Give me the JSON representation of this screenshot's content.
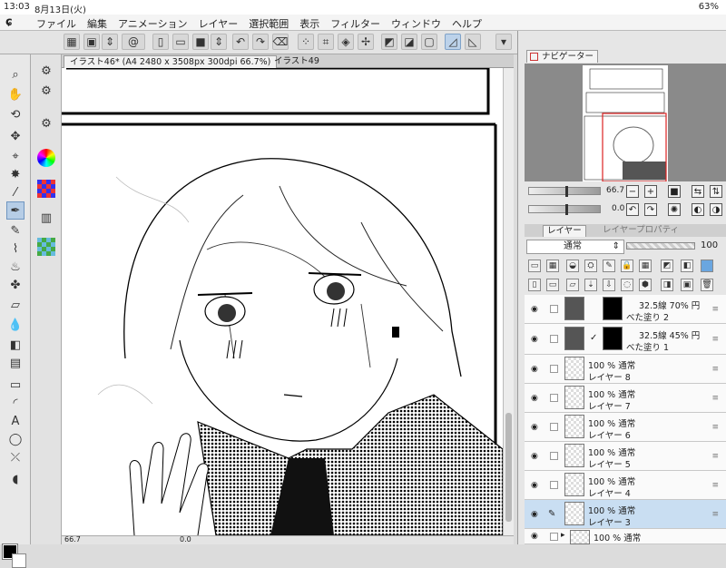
{
  "status": {
    "time": "13:03",
    "date": "8月13日(火)",
    "battery": "63%"
  },
  "menu": {
    "items": [
      "ファイル",
      "編集",
      "アニメーション",
      "レイヤー",
      "選択範囲",
      "表示",
      "フィルター",
      "ウィンドウ",
      "ヘルプ"
    ]
  },
  "tabs": [
    {
      "label": "イラスト46* (A4 2480 x 3508px 300dpi 66.7%)",
      "active": true
    },
    {
      "label": "イラスト49",
      "active": false
    }
  ],
  "navigator": {
    "tab_label": "ナビゲーター",
    "zoom": "66.7",
    "rotation": "0.0"
  },
  "layer_panel": {
    "tab_layer": "レイヤー",
    "tab_property": "レイヤープロパティ",
    "blend_mode": "通常",
    "opacity": "100",
    "layers": [
      {
        "line1": "32.5線 70% 円",
        "line2": "べた塗り 2",
        "type": "fill",
        "selected": false
      },
      {
        "line1": "32.5線 45% 円",
        "line2": "べた塗り 1",
        "type": "fill",
        "selected": false
      },
      {
        "line1": "100 % 通常",
        "line2": "レイヤー 8",
        "type": "raster",
        "selected": false
      },
      {
        "line1": "100 % 通常",
        "line2": "レイヤー 7",
        "type": "raster",
        "selected": false
      },
      {
        "line1": "100 % 通常",
        "line2": "レイヤー 6",
        "type": "raster",
        "selected": false
      },
      {
        "line1": "100 % 通常",
        "line2": "レイヤー 5",
        "type": "raster",
        "selected": false
      },
      {
        "line1": "100 % 通常",
        "line2": "レイヤー 4",
        "type": "raster",
        "selected": false
      },
      {
        "line1": "100 % 通常",
        "line2": "レイヤー 3",
        "type": "raster",
        "selected": true
      },
      {
        "line1": "100 % 通常",
        "line2": "",
        "type": "raster",
        "selected": false
      }
    ]
  },
  "bottom": {
    "zoom": "66.7",
    "rotation": "0.0"
  },
  "colors": {
    "main": "#000000",
    "sub": "#ffffff",
    "accent": "#c9def2"
  }
}
